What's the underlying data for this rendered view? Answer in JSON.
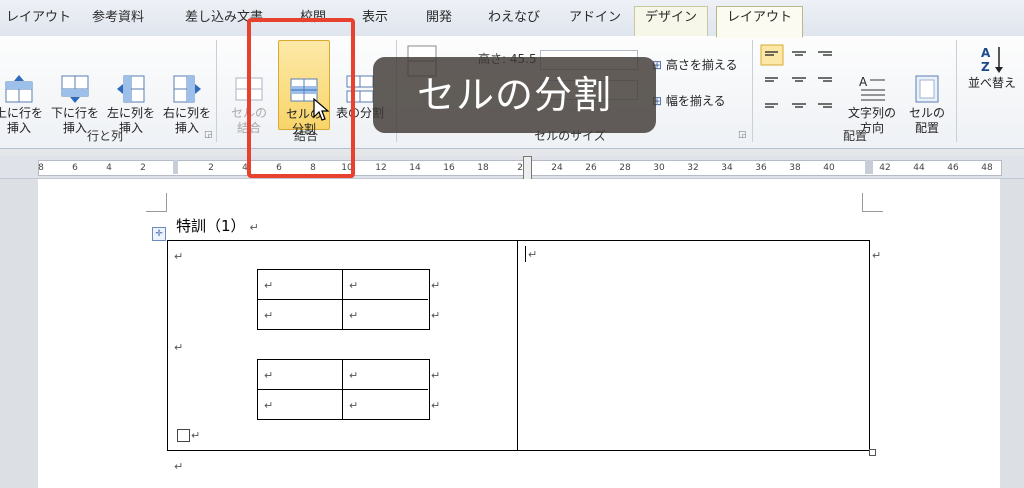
{
  "tabs": [
    "レイアウト",
    "参考資料",
    "差し込み文書",
    "校閲",
    "表示",
    "開発",
    "わえなび",
    "アドイン",
    "デザイン",
    "レイアウト"
  ],
  "ribbon": {
    "rows_cols": {
      "insert_above": "上に行を\n挿入",
      "insert_below": "下に行を\n挿入",
      "insert_left": "左に列を\n挿入",
      "insert_right": "右に列を\n挿入",
      "group_label": "行と列"
    },
    "merge": {
      "merge_cells": "セルの\n結合",
      "split_cells": "セルの\n分割",
      "split_table": "表の分割",
      "group_label": "結合"
    },
    "cell_size": {
      "height_value": "高さ: 45.5 mm",
      "distribute_rows": "高さを揃える",
      "distribute_cols": "幅を揃える",
      "group_label": "セルのサイズ"
    },
    "alignment": {
      "text_direction": "文字列の\n方向",
      "cell_margins": "セルの\n配置",
      "group_label": "配置"
    },
    "sort_label": "並べ替え"
  },
  "ruler": {
    "numbers": [
      "8",
      "6",
      "4",
      "2",
      "2",
      "4",
      "6",
      "8",
      "10",
      "12",
      "14",
      "16",
      "18",
      "22",
      "24",
      "26",
      "28",
      "30",
      "32",
      "34",
      "36",
      "38",
      "40",
      "42",
      "44",
      "46",
      "48"
    ]
  },
  "document": {
    "heading": "特訓（1）",
    "para_mark": "↵"
  },
  "caption": "セルの分割"
}
